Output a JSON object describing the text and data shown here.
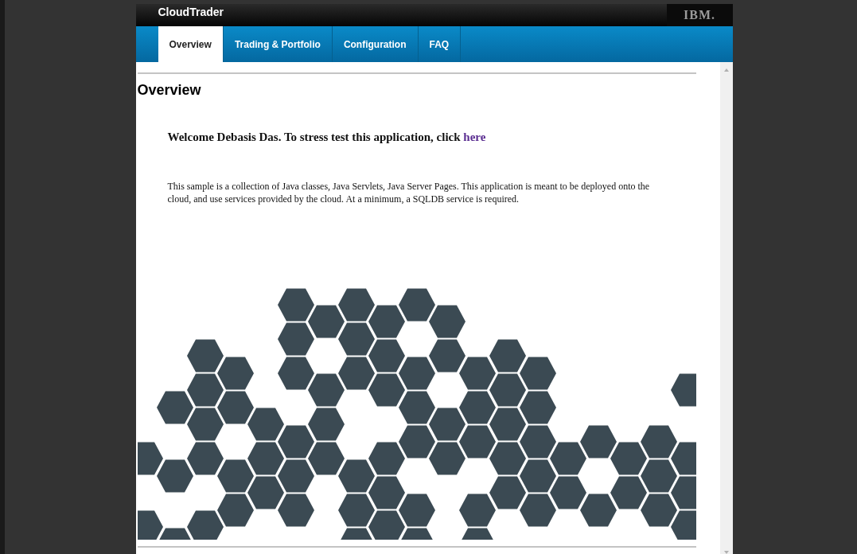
{
  "header": {
    "app_title": "CloudTrader",
    "logo": "IBM."
  },
  "tabs": [
    {
      "label": "Overview",
      "selected": true
    },
    {
      "label": "Trading & Portfolio",
      "selected": false
    },
    {
      "label": "Configuration",
      "selected": false
    },
    {
      "label": "FAQ",
      "selected": false
    }
  ],
  "content": {
    "heading": "Overview",
    "welcome": "Welcome Debasis Das. To stress test this application, click",
    "welcome_link": "here",
    "description": "This sample is a collection of Java classes, Java Servlets, Java Server Pages. This application is meant to be deployed onto the cloud, and use services provided by the cloud. At a minimum, a SQLDB service is required."
  }
}
